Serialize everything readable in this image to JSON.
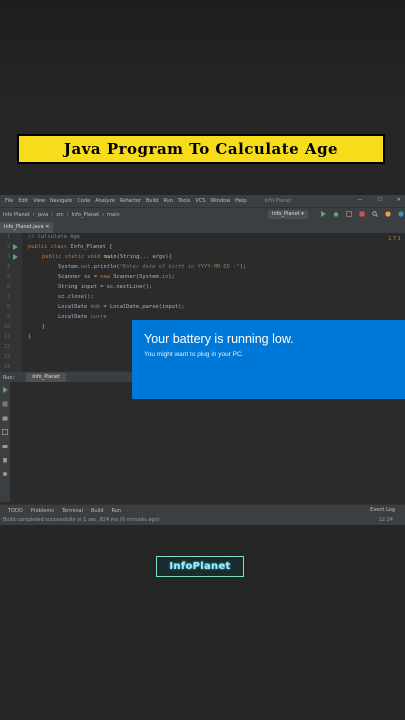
{
  "banner": {
    "title": "Java Program To Calculate Age"
  },
  "ide": {
    "menu": [
      "File",
      "Edit",
      "View",
      "Navigate",
      "Code",
      "Analyze",
      "Refactor",
      "Build",
      "Run",
      "Tools",
      "VCS",
      "Window",
      "Help"
    ],
    "window_title": "Info Planet",
    "breadcrumbs": [
      "Info Planet",
      "java",
      "src",
      "Info_Planet",
      "main"
    ],
    "run_config": "Info_Planet",
    "open_tab": "Info_Planet.java",
    "warnings": "1  7  1",
    "line_numbers": [
      "1",
      "2",
      "3",
      "4",
      "5",
      "6",
      "7",
      "8",
      "9",
      "10",
      "11",
      "12",
      "13",
      "14"
    ],
    "code": {
      "l1": "// Calculate Age",
      "l2_kw": "public class ",
      "l2_name": "Info_Planet {",
      "l3_kw": "public static void ",
      "l3_fn": "main",
      "l3_rest": "(String... args){",
      "l4_a": "System.",
      "l4_b": "out",
      "l4_c": ".println(",
      "l4_str": "\"Enter date of birth in YYYY-MM-DD :\"",
      "l4_d": ");",
      "l5_a": "Scanner sc = ",
      "l5_kw": "new ",
      "l5_b": "Scanner(System.",
      "l5_c": "in",
      "l5_d": ");",
      "l6": "String input = sc.nextLine();",
      "l7": "sc.close();",
      "l8_a": "LocalDate ",
      "l8_b": "dob",
      "l8_c": " = LocalDate.",
      "l8_d": "parse",
      "l8_e": "(input);",
      "l9_a": "LocalDate ",
      "l9_b": "curre",
      "l10": "}",
      "l11": "}"
    },
    "run_label": "Run:",
    "run_tab": "Info_Planet",
    "bottom_tabs": [
      "TODO",
      "Problems",
      "Terminal",
      "Build",
      "Run"
    ],
    "event_log": "Event Log",
    "status_text": "Build completed successfully in 1 sec, 824 ms (6 minutes ago)",
    "status_time": "12:24"
  },
  "notification": {
    "title": "Your battery is running low.",
    "message": "You might want to plug in your PC."
  },
  "logo": {
    "text": "InfoPlanet"
  },
  "colors": {
    "banner": "#f6dc1b",
    "toast": "#0078d7",
    "ide_bg": "#2b2b2b",
    "page_bg": "#262626"
  }
}
